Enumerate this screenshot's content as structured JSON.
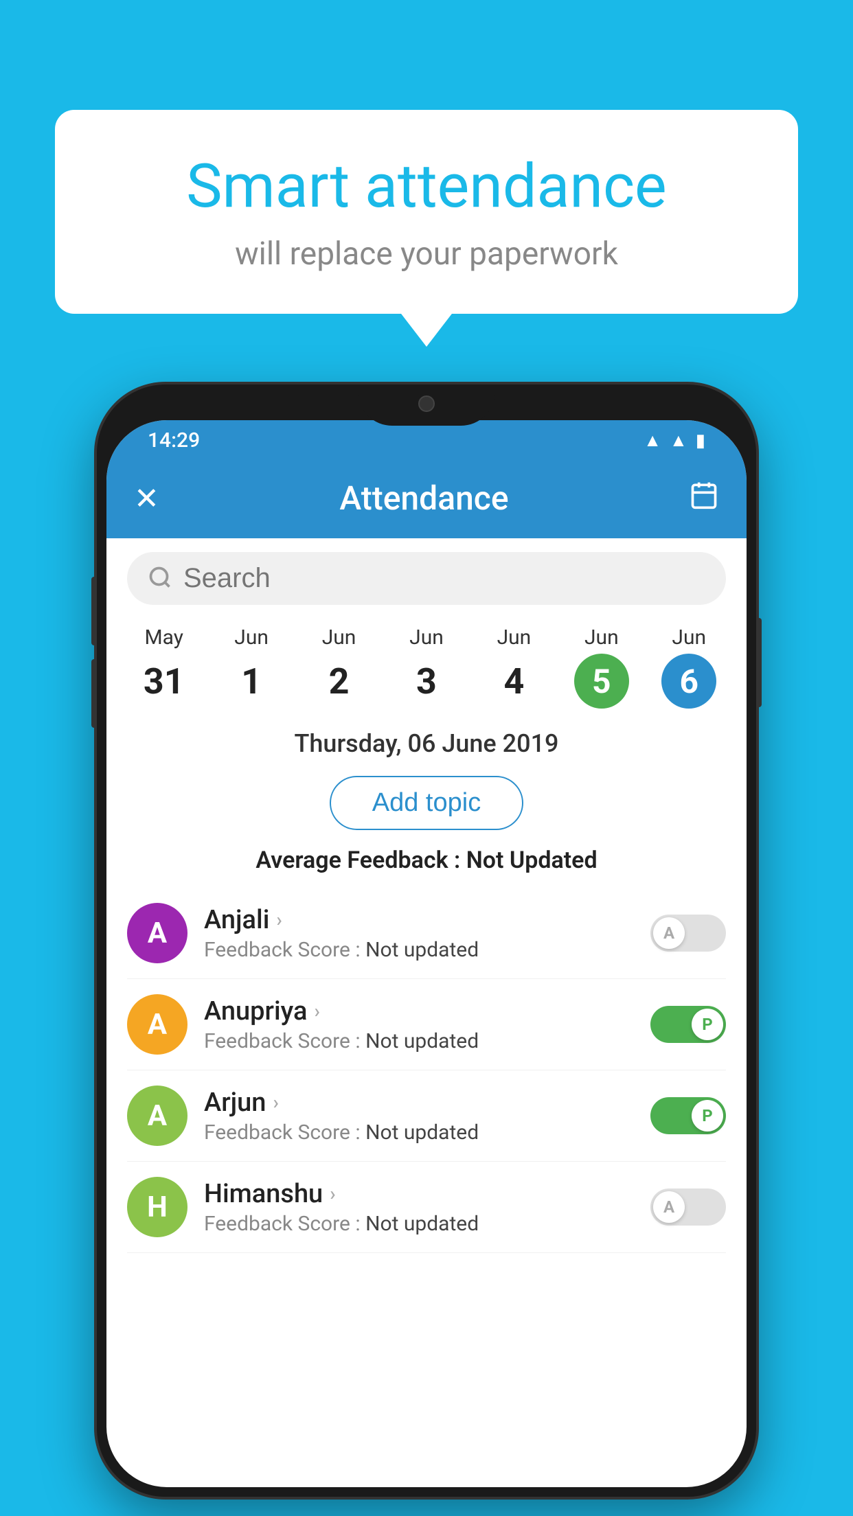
{
  "background_color": "#1ab9e8",
  "speech_bubble": {
    "title": "Smart attendance",
    "subtitle": "will replace your paperwork"
  },
  "status_bar": {
    "time": "14:29",
    "icons": [
      "wifi",
      "signal",
      "battery"
    ]
  },
  "app_header": {
    "title": "Attendance",
    "close_label": "✕",
    "calendar_label": "📅"
  },
  "search": {
    "placeholder": "Search"
  },
  "dates": [
    {
      "month": "May",
      "day": "31",
      "style": "normal"
    },
    {
      "month": "Jun",
      "day": "1",
      "style": "normal"
    },
    {
      "month": "Jun",
      "day": "2",
      "style": "normal"
    },
    {
      "month": "Jun",
      "day": "3",
      "style": "normal"
    },
    {
      "month": "Jun",
      "day": "4",
      "style": "normal"
    },
    {
      "month": "Jun",
      "day": "5",
      "style": "today"
    },
    {
      "month": "Jun",
      "day": "6",
      "style": "selected"
    }
  ],
  "selected_date_label": "Thursday, 06 June 2019",
  "add_topic_label": "Add topic",
  "avg_feedback_label": "Average Feedback : ",
  "avg_feedback_value": "Not Updated",
  "students": [
    {
      "name": "Anjali",
      "avatar_letter": "A",
      "avatar_color": "#9c27b0",
      "feedback_label": "Feedback Score : ",
      "feedback_value": "Not updated",
      "toggle": "off",
      "toggle_label": "A"
    },
    {
      "name": "Anupriya",
      "avatar_letter": "A",
      "avatar_color": "#f5a623",
      "feedback_label": "Feedback Score : ",
      "feedback_value": "Not updated",
      "toggle": "on",
      "toggle_label": "P"
    },
    {
      "name": "Arjun",
      "avatar_letter": "A",
      "avatar_color": "#8bc34a",
      "feedback_label": "Feedback Score : ",
      "feedback_value": "Not updated",
      "toggle": "on",
      "toggle_label": "P"
    },
    {
      "name": "Himanshu",
      "avatar_letter": "H",
      "avatar_color": "#8bc34a",
      "feedback_label": "Feedback Score : ",
      "feedback_value": "Not updated",
      "toggle": "off",
      "toggle_label": "A"
    }
  ]
}
